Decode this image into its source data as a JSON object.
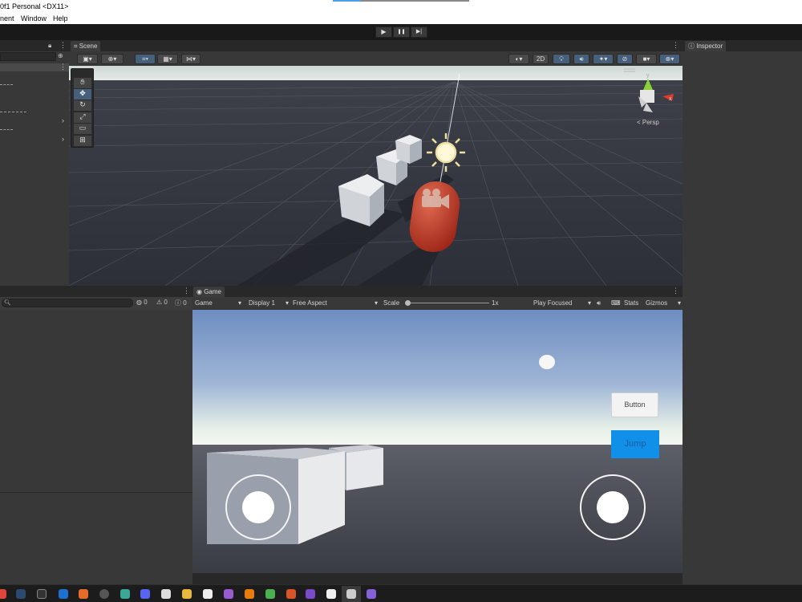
{
  "window": {
    "title": "0f1 Personal <DX11>"
  },
  "menu": {
    "items": [
      "nent",
      "Window",
      "Help"
    ]
  },
  "playbar": {
    "play": "▶",
    "pause": "❚❚",
    "step": "▶|"
  },
  "scene": {
    "tab": "Scene",
    "toggle_2d": "2D",
    "persp_label": "< Persp",
    "gizmo_x": "x",
    "gizmo_y": "y"
  },
  "inspector": {
    "tab": "Inspector"
  },
  "console": {
    "count_msgs": "0",
    "count_warn": "0",
    "count_err": "0"
  },
  "game": {
    "tab": "Game",
    "view_select": "Game",
    "display_select": "Display 1",
    "aspect_select": "Free Aspect",
    "scale_label": "Scale",
    "scale_value": "1x",
    "play_mode": "Play Focused",
    "stats": "Stats",
    "gizmos": "Gizmos",
    "button_label": "Button",
    "jump_label": "Jump"
  },
  "taskbar": {
    "icons": [
      "chrome-icon",
      "steam-icon",
      "epic-icon",
      "media-icon",
      "firefox-icon",
      "obs-icon",
      "terminal-icon",
      "discord-icon",
      "xbox-icon",
      "folder-icon",
      "unity-hub-icon",
      "github-icon",
      "blender-icon",
      "chrome-alt-icon",
      "office-icon",
      "shotcut-icon",
      "notes-icon",
      "unity-icon",
      "skull-app-icon",
      "visual-studio-icon"
    ]
  },
  "colors": {
    "accent": "#3a79bb",
    "jump_button": "#1090e8",
    "capsule": "#c03a28",
    "sky_top": "#6d8cc0"
  }
}
